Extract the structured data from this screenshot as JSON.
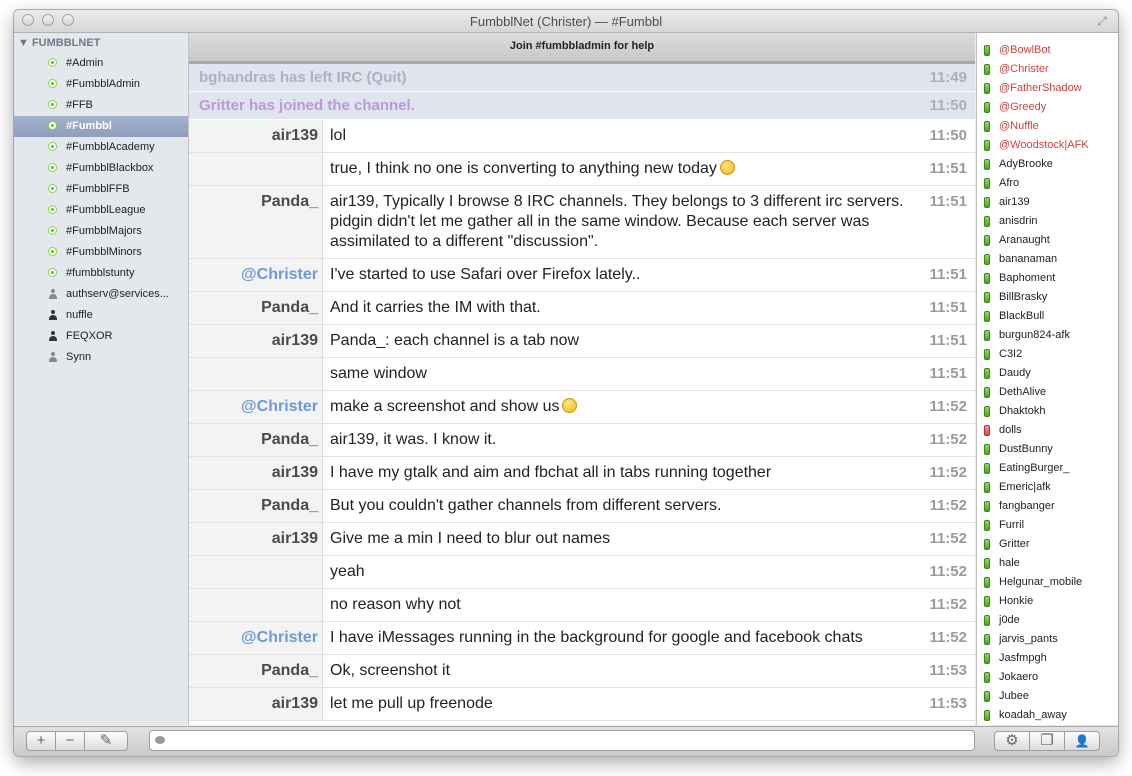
{
  "window": {
    "title": "FumbblNet (Christer) — #Fumbbl"
  },
  "sidebar": {
    "group": "FUMBBLNET",
    "channels": [
      "#Admin",
      "#FumbblAdmin",
      "#FFB",
      "#Fumbbl",
      "#FumbblAcademy",
      "#FumbblBlackbox",
      "#FumbblFFB",
      "#FumbblLeague",
      "#FumbblMajors",
      "#FumbblMinors",
      "#fumbblstunty"
    ],
    "selected_channel": "#Fumbbl",
    "queries": [
      "authserv@services...",
      "nuffle",
      "FEQXOR",
      "Synn"
    ]
  },
  "topic": "Join #fumbbladmin for help",
  "status_messages": [
    {
      "text": "bghandras has left IRC (Quit)",
      "time": "11:49",
      "color": "#a9b3c4"
    },
    {
      "text": "Gritter has joined the channel.",
      "time": "11:50",
      "color": "#b99ad4"
    }
  ],
  "messages": [
    {
      "nick": "air139",
      "text": "lol",
      "time": "11:50"
    },
    {
      "nick": "",
      "text": "true, I think no one is converting to anything new today",
      "time": "11:51",
      "smiley": "wink"
    },
    {
      "nick": "Panda_",
      "text": "air139, Typically I browse 8 IRC channels. They belongs to 3 different irc servers. pidgin didn't let me gather all in the same window. Because each server was assimilated to a different \"discussion\".",
      "time": "11:51"
    },
    {
      "nick": "@Christer",
      "text": "I've started to use Safari over Firefox lately..",
      "time": "11:51",
      "me": true
    },
    {
      "nick": "Panda_",
      "text": "And it carries the IM with that.",
      "time": "11:51"
    },
    {
      "nick": "air139",
      "text": "Panda_: each channel is a tab now",
      "time": "11:51"
    },
    {
      "nick": "",
      "text": "same window",
      "time": "11:51"
    },
    {
      "nick": "@Christer",
      "text": "make a screenshot and show us",
      "time": "11:52",
      "me": true,
      "smiley": "smile"
    },
    {
      "nick": "Panda_",
      "text": "air139, it was. I know it.",
      "time": "11:52"
    },
    {
      "nick": "air139",
      "text": "I have my gtalk and aim and fbchat all in tabs running together",
      "time": "11:52"
    },
    {
      "nick": "Panda_",
      "text": "But you couldn't gather channels from different servers.",
      "time": "11:52"
    },
    {
      "nick": "air139",
      "text": "Give me a min I need to blur out names",
      "time": "11:52"
    },
    {
      "nick": "",
      "text": "yeah",
      "time": "11:52"
    },
    {
      "nick": "",
      "text": "no reason why not",
      "time": "11:52"
    },
    {
      "nick": "@Christer",
      "text": "I have iMessages running in the background for google and facebook chats",
      "time": "11:52",
      "me": true
    },
    {
      "nick": "Panda_",
      "text": "Ok, screenshot it",
      "time": "11:53"
    },
    {
      "nick": "air139",
      "text": "let me pull up freenode",
      "time": "11:53"
    }
  ],
  "users": [
    {
      "name": "@BowlBot",
      "op": true
    },
    {
      "name": "@Christer",
      "op": true
    },
    {
      "name": "@FatherShadow",
      "op": true
    },
    {
      "name": "@Greedy",
      "op": true
    },
    {
      "name": "@Nuffle",
      "op": true
    },
    {
      "name": "@Woodstock|AFK",
      "op": true
    },
    {
      "name": "AdyBrooke"
    },
    {
      "name": "Afro"
    },
    {
      "name": "air139"
    },
    {
      "name": "anisdrin"
    },
    {
      "name": "Aranaught"
    },
    {
      "name": "bananaman"
    },
    {
      "name": "Baphoment"
    },
    {
      "name": "BillBrasky"
    },
    {
      "name": "BlackBull"
    },
    {
      "name": "burgun824-afk"
    },
    {
      "name": "C3I2"
    },
    {
      "name": "Daudy"
    },
    {
      "name": "DethAlive"
    },
    {
      "name": "Dhaktokh"
    },
    {
      "name": "dolls",
      "away": true
    },
    {
      "name": "DustBunny"
    },
    {
      "name": "EatingBurger_"
    },
    {
      "name": "Emeric|afk"
    },
    {
      "name": "fangbanger"
    },
    {
      "name": "Furril"
    },
    {
      "name": "Gritter"
    },
    {
      "name": "hale"
    },
    {
      "name": "Helgunar_mobile"
    },
    {
      "name": "Honkie"
    },
    {
      "name": "j0de"
    },
    {
      "name": "jarvis_pants"
    },
    {
      "name": "Jasfmpgh"
    },
    {
      "name": "Jokaero"
    },
    {
      "name": "Jubee"
    },
    {
      "name": "koadah_away"
    }
  ],
  "bottom": {
    "add": "+",
    "remove": "−",
    "edit": "✎",
    "settings": "⚙",
    "windows": "❐",
    "user": "👤",
    "input_value": ""
  }
}
